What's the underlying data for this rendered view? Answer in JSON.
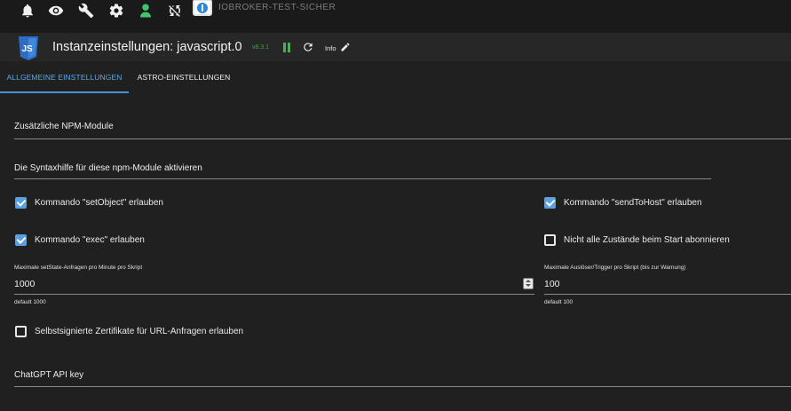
{
  "topbar": {
    "icons": [
      "bell-icon",
      "eye-icon",
      "wrench-icon",
      "settings-icon",
      "user-icon",
      "sync-disabled-icon"
    ],
    "brand": "IOBROKER-TEST-SICHER"
  },
  "header": {
    "title": "Instanzeinstellungen: javascript.0",
    "version": "v8.3.1",
    "info_label": "Info"
  },
  "tabs": [
    {
      "label": "ALLGEMEINE EINSTELLUNGEN",
      "active": true
    },
    {
      "label": "ASTRO-EINSTELLUNGEN",
      "active": false
    }
  ],
  "form": {
    "npm_modules_label": "Zusätzliche NPM-Module",
    "syntax_help_label": "Die Syntaxhilfe für diese npm-Module aktivieren",
    "checkboxes": {
      "set_object": {
        "label": "Kommando \"setObject\" erlauben",
        "checked": true
      },
      "send_to_host": {
        "label": "Kommando \"sendToHost\" erlauben",
        "checked": true
      },
      "exec": {
        "label": "Kommando \"exec\" erlauben",
        "checked": true
      },
      "not_all_states": {
        "label": "Nicht alle Zustände beim Start abonnieren",
        "checked": false
      },
      "self_signed": {
        "label": "Selbstsignierte Zertifikate für URL-Anfragen erlauben",
        "checked": false
      }
    },
    "max_setstate": {
      "label": "Maximale setState-Anfragen pro Minute pro Skript",
      "value": "1000",
      "helper": "default 1000"
    },
    "max_triggers": {
      "label": "Maximale Auslöser/Trigger pro Skript (bis zur Warnung)",
      "value": "100",
      "helper": "default 100"
    },
    "chatgpt_label": "ChatGPT API key"
  },
  "colors": {
    "accent": "#5a9fe0",
    "running": "#4caf50",
    "background": "#202020"
  }
}
